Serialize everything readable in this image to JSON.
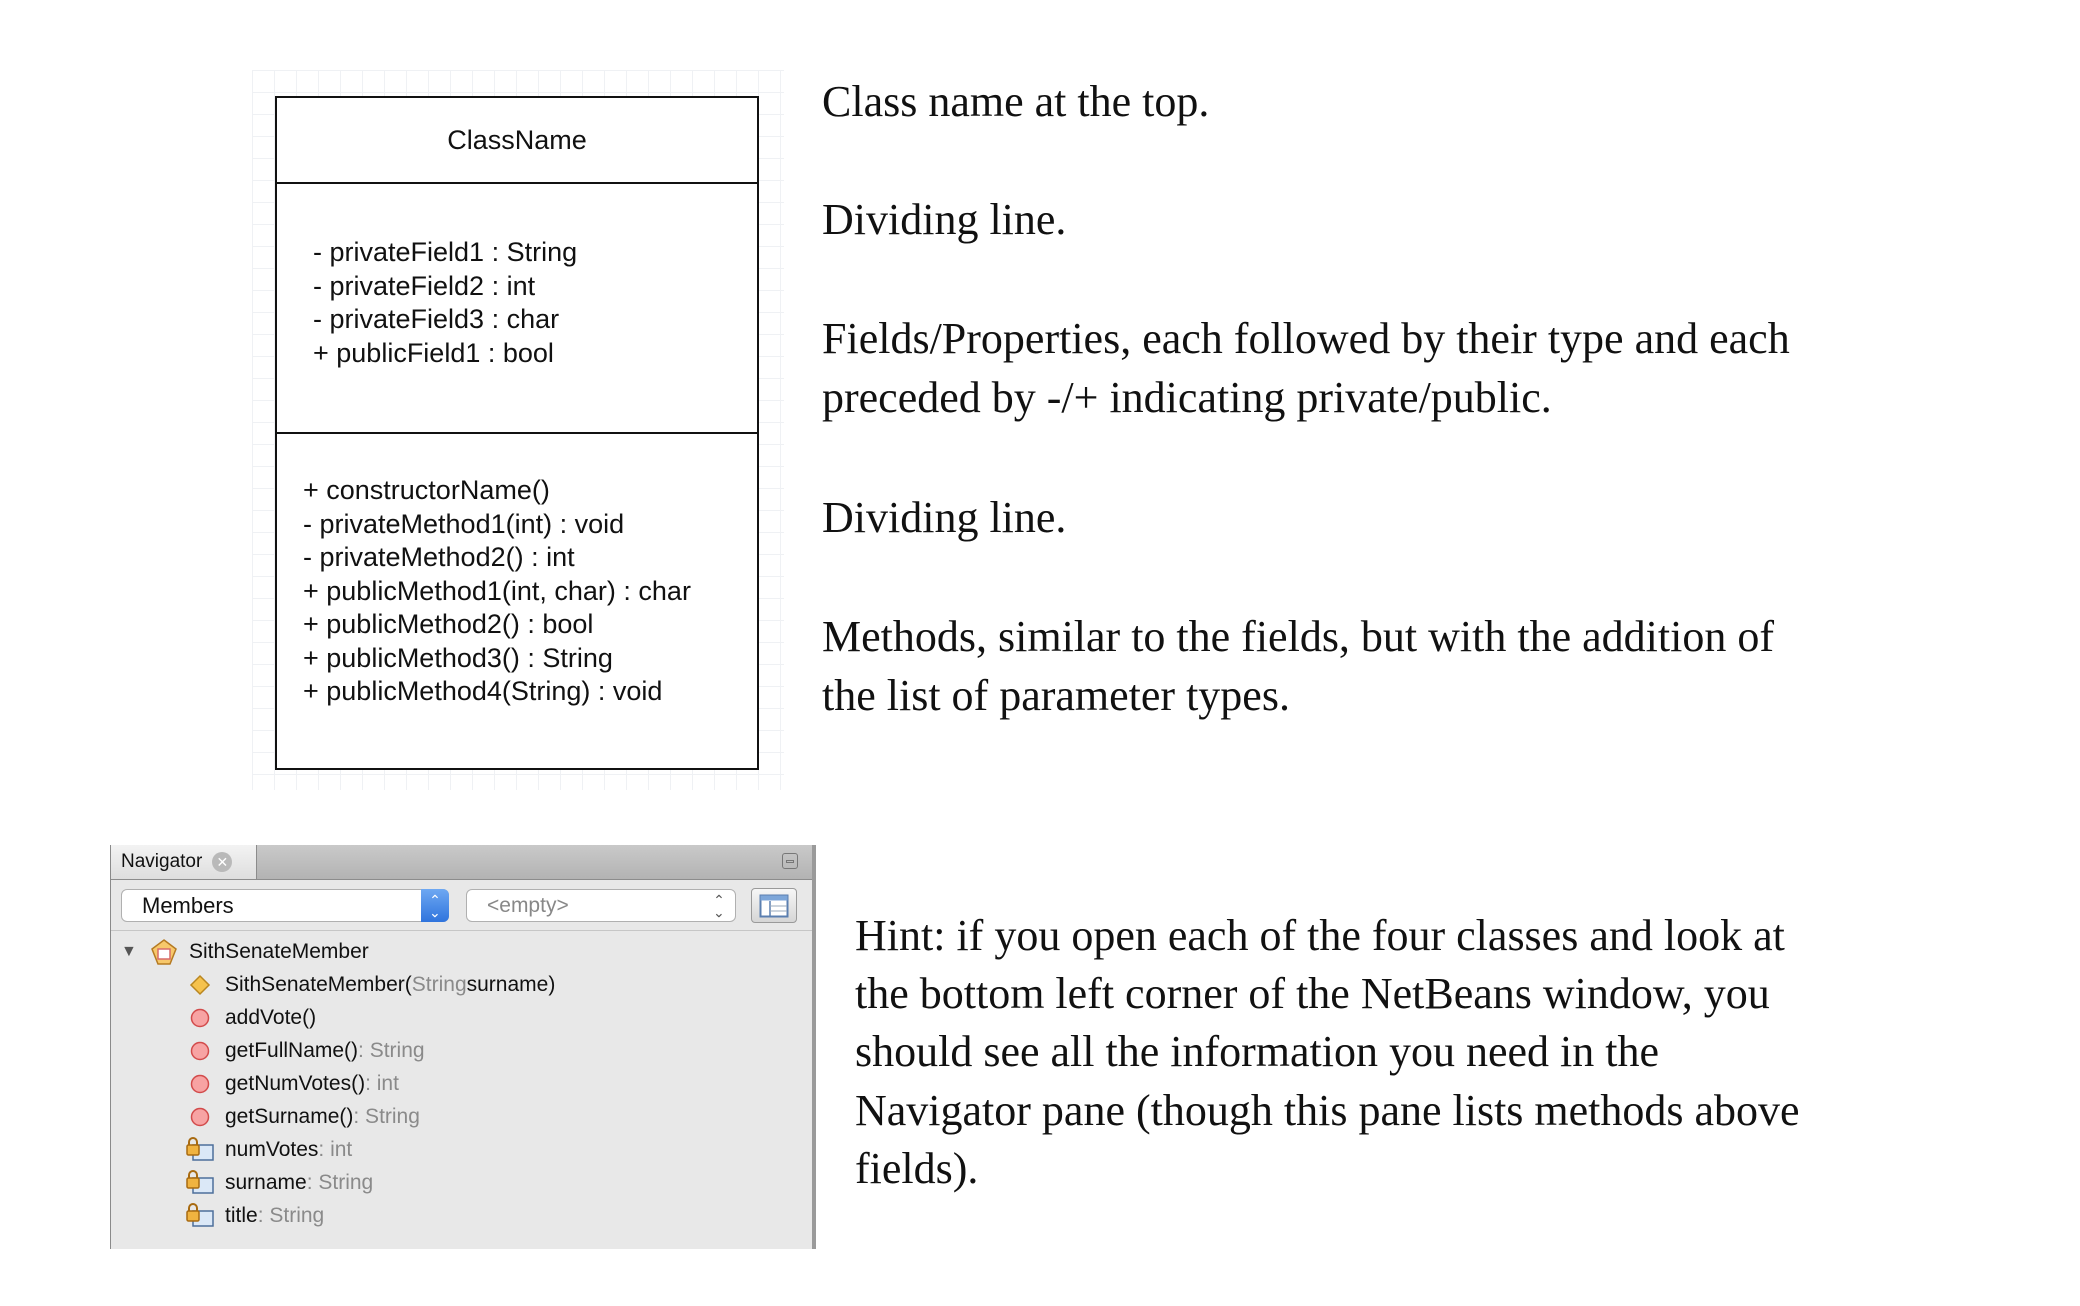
{
  "uml": {
    "class_name": "ClassName",
    "fields": [
      "- privateField1 : String",
      "- privateField2 : int",
      "- privateField3 : char",
      "+ publicField1 : bool"
    ],
    "methods": [
      "+ constructorName()",
      "- privateMethod1(int) : void",
      "- privateMethod2() : int",
      "+ publicMethod1(int, char) : char",
      "+ publicMethod2() : bool",
      "+ publicMethod3() : String",
      "+ publicMethod4(String) : void"
    ]
  },
  "descriptions": {
    "class_name": "Class name at the top.",
    "divider_1": "Dividing line.",
    "fields_line1": "Fields/Properties, each followed by their type and each",
    "fields_line2": "preceded by -/+ indicating private/public.",
    "divider_2": "Dividing line.",
    "methods_line1": "Methods, similar to the fields, but with the addition of",
    "methods_line2": "the list of parameter types."
  },
  "navigator": {
    "tab_label": "Navigator",
    "view_select": "Members",
    "filter_select": "<empty>",
    "class_node": "SithSenateMember",
    "members": [
      {
        "name": "SithSenateMember(",
        "type": "String",
        "after": " surname)",
        "kind": "constructor"
      },
      {
        "name": "addVote()",
        "type": "",
        "after": "",
        "kind": "method"
      },
      {
        "name": "getFullName()",
        "type": " : String",
        "after": "",
        "kind": "method"
      },
      {
        "name": "getNumVotes()",
        "type": " : int",
        "after": "",
        "kind": "method"
      },
      {
        "name": "getSurname()",
        "type": " : String",
        "after": "",
        "kind": "method"
      },
      {
        "name": "numVotes",
        "type": " : int",
        "after": "",
        "kind": "field"
      },
      {
        "name": "surname",
        "type": " : String",
        "after": "",
        "kind": "field"
      },
      {
        "name": "title",
        "type": " : String",
        "after": "",
        "kind": "field"
      }
    ]
  },
  "hint": {
    "lines": [
      "Hint: if you open each of the four classes and look at",
      "the bottom left corner of the NetBeans window, you",
      "should see all the information you need in the",
      "Navigator pane (though this pane lists methods above",
      "fields)."
    ]
  },
  "colors": {
    "constructor_icon": "#f0b23a",
    "method_icon": "#f08a8a",
    "field_icon": "#e9b04a",
    "combo_accent": "#2f74dd"
  }
}
